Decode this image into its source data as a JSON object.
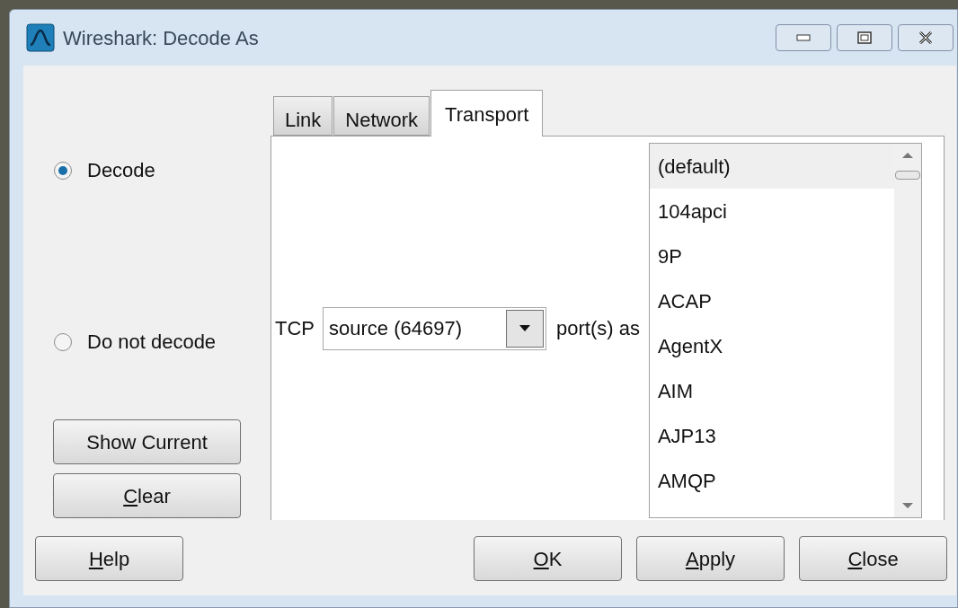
{
  "window": {
    "title": "Wireshark: Decode As"
  },
  "decode_options": [
    {
      "label": "Decode",
      "selected": true
    },
    {
      "label": "Do not decode",
      "selected": false
    }
  ],
  "side_buttons": [
    {
      "label": "Show Current",
      "underline_first": false
    },
    {
      "label": "Clear",
      "underline_first": true
    }
  ],
  "tabs": [
    {
      "label": "Link",
      "selected": false
    },
    {
      "label": "Network",
      "selected": false
    },
    {
      "label": "Transport",
      "selected": true
    }
  ],
  "protocol_label": "TCP",
  "port_combo": {
    "value": "source (64697)"
  },
  "port_suffix": "port(s) as",
  "protocol_list": [
    {
      "label": "(default)",
      "selected": true
    },
    {
      "label": "104apci",
      "selected": false
    },
    {
      "label": "9P",
      "selected": false
    },
    {
      "label": "ACAP",
      "selected": false
    },
    {
      "label": "AgentX",
      "selected": false
    },
    {
      "label": "AIM",
      "selected": false
    },
    {
      "label": "AJP13",
      "selected": false
    },
    {
      "label": "AMQP",
      "selected": false
    }
  ],
  "help_button": {
    "label": "Help",
    "underline_first": true
  },
  "dialog_buttons": [
    {
      "label": "OK",
      "underline_first": true
    },
    {
      "label": "Apply",
      "underline_first": true
    },
    {
      "label": "Close",
      "underline_first": true
    }
  ]
}
